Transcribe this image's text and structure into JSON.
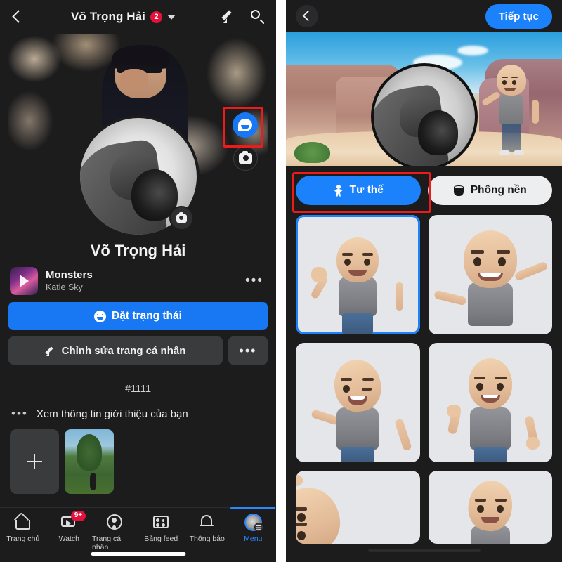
{
  "left": {
    "header": {
      "back_icon": "back-chevron-icon",
      "title": "Võ Trọng Hải",
      "badge": "2",
      "caret_icon": "chevron-down-icon",
      "edit_icon": "pencil-icon",
      "search_icon": "search-icon"
    },
    "cover": {
      "avatar_button_icon": "messenger-avatar-icon",
      "camera_button_icon": "camera-icon",
      "highlight_color": "#ef1b1b"
    },
    "profile": {
      "name": "Võ Trọng Hải",
      "photo_camera_icon": "camera-icon"
    },
    "music": {
      "title": "Monsters",
      "artist": "Katie Sky",
      "play_icon": "play-icon",
      "more_icon": "ellipsis-icon"
    },
    "actions": {
      "status_label": "Đặt trạng thái",
      "status_icon": "smiley-face-icon",
      "edit_profile_label": "Chỉnh sửa trang cá nhân",
      "edit_profile_icon": "pencil-icon",
      "more_label": "•••",
      "primary_color": "#1877f2"
    },
    "hashtag": "#1111",
    "about": {
      "dots_icon": "ellipsis-icon",
      "text": "Xem thông tin giới thiệu của bạn"
    },
    "photos": {
      "add_icon": "plus-icon"
    },
    "bottom_nav": [
      {
        "label": "Trang chủ",
        "icon": "home-icon",
        "badge": "",
        "active": false
      },
      {
        "label": "Watch",
        "icon": "watch-icon",
        "badge": "9+",
        "active": false
      },
      {
        "label": "Trang cá nhân",
        "icon": "person-icon",
        "badge": "",
        "active": false
      },
      {
        "label": "Bảng feed",
        "icon": "feed-icon",
        "badge": "",
        "active": false
      },
      {
        "label": "Thông báo",
        "icon": "bell-icon",
        "badge": "",
        "active": false
      },
      {
        "label": "Menu",
        "icon": "menu-avatar-icon",
        "badge": "",
        "active": true
      }
    ],
    "active_color": "#2d88ff"
  },
  "right": {
    "header": {
      "back_icon": "back-chevron-icon",
      "continue_label": "Tiếp tục",
      "continue_color": "#1b82fb"
    },
    "tabs": [
      {
        "label": "Tư thế",
        "icon": "pose-icon",
        "selected": true
      },
      {
        "label": "Phông nền",
        "icon": "paint-bucket-icon",
        "selected": false
      }
    ],
    "tab_highlight_color": "#ef1b1b",
    "grid": [
      {
        "name": "pose-wave",
        "selected": true
      },
      {
        "name": "pose-arms-out",
        "selected": false
      },
      {
        "name": "pose-wink-lean",
        "selected": false
      },
      {
        "name": "pose-flex",
        "selected": false
      },
      {
        "name": "pose-close-up",
        "selected": false
      },
      {
        "name": "pose-look-up",
        "selected": false
      }
    ]
  }
}
